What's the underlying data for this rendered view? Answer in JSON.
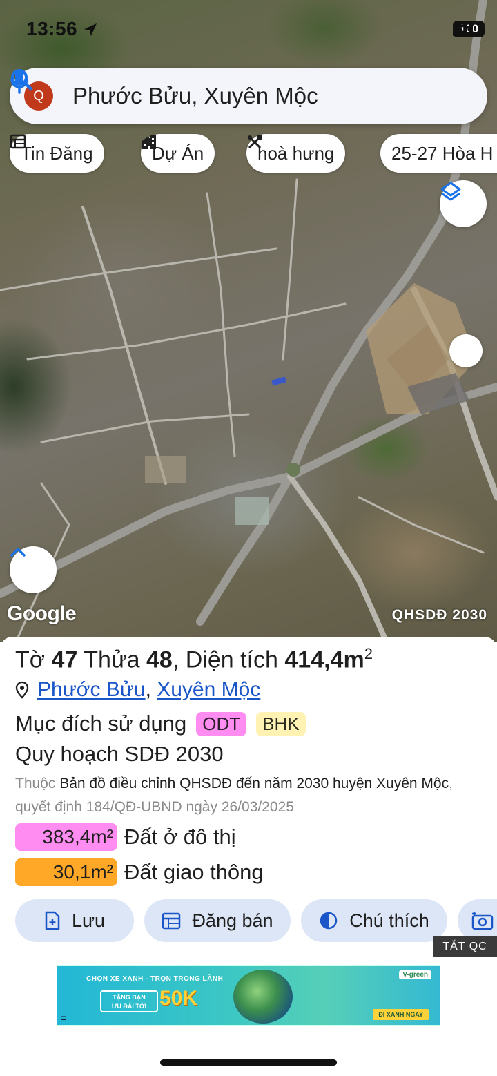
{
  "status_bar": {
    "time": "13:56",
    "battery": "100"
  },
  "search": {
    "query": "Phước Bửu, Xuyên Mộc",
    "avatar_letter": "Q"
  },
  "chips": [
    {
      "label": "Tin Đăng",
      "icon": "listing-icon"
    },
    {
      "label": "Dự Án",
      "icon": "building-icon"
    },
    {
      "label": "hoà hưng",
      "icon": "tools-icon"
    },
    {
      "label": "25-27 Hòa H",
      "icon": "none"
    }
  ],
  "map": {
    "attribution": "Google",
    "layer_label": "QHSDĐ 2030"
  },
  "parcel": {
    "sheet_label": "Tờ",
    "sheet_no": "47",
    "lot_label": "Thửa",
    "lot_no": "48",
    "area_label": ", Diện tích",
    "area_value": "414,4m",
    "area_unit_sup": "2",
    "ward": "Phước Bửu",
    "district": "Xuyên Mộc",
    "purpose_label": "Mục đích sử dụng",
    "purpose_tags": [
      "ODT",
      "BHK"
    ],
    "plan_title": "Quy hoạch SDĐ 2030",
    "plan_prefix": "Thuộc",
    "plan_doc": "Bản đồ điều chỉnh QHSDĐ đến năm 2030 huyện Xuyên Mộc",
    "plan_decision": ", quyết định 184/QĐ-UBND ngày 26/03/2025",
    "areas": [
      {
        "value": "383,4m²",
        "label": "Đất ở đô thị",
        "color": "#ff8cf0"
      },
      {
        "value": "30,1m²",
        "label": "Đất giao thông",
        "color": "#ffa726"
      }
    ]
  },
  "actions": [
    {
      "label": "Lưu",
      "icon": "save-doc-icon"
    },
    {
      "label": "Đăng bán",
      "icon": "calendar-post-icon"
    },
    {
      "label": "Chú thích",
      "icon": "contrast-icon"
    },
    {
      "label": "",
      "icon": "camera-icon"
    }
  ],
  "ad": {
    "close_label": "TẮT QC",
    "headline": "CHỌN XE XANH - TRỌN TRONG LÀNH",
    "offer_line1": "TẶNG BẠN",
    "offer_line2": "ƯU ĐÃI TỚI",
    "amount": "50K",
    "brand": "V-green",
    "cta": "ĐI XANH NGAY",
    "menu_glyph": "="
  },
  "colors": {
    "link": "#1a56c8",
    "action_bg": "#dde6f7",
    "avatar": "#c0391b",
    "search_icon": "#1a73e8"
  }
}
